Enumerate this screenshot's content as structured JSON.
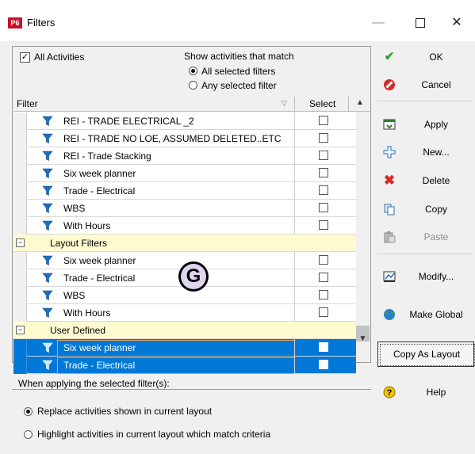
{
  "window": {
    "app_badge": "P6",
    "title": "Filters",
    "minimize": "—",
    "close": "✕"
  },
  "options": {
    "all_activities_label": "All Activities",
    "all_activities_checked": true,
    "show_match_label": "Show activities that match",
    "match_all_label": "All selected filters",
    "match_any_label": "Any selected filter",
    "selected_match": "all"
  },
  "grid": {
    "col_filter": "Filter",
    "col_select": "Select",
    "rows": [
      {
        "type": "item",
        "label": "REI - TRADE ELECTRICAL _2"
      },
      {
        "type": "item",
        "label": "REI - TRADE NO LOE, ASSUMED DELETED..ETC"
      },
      {
        "type": "item",
        "label": "REI - Trade Stacking"
      },
      {
        "type": "item",
        "label": "Six week planner"
      },
      {
        "type": "item",
        "label": "Trade - Electrical"
      },
      {
        "type": "item",
        "label": "WBS"
      },
      {
        "type": "item",
        "label": "With Hours"
      },
      {
        "type": "group",
        "label": "Layout Filters",
        "expander": "−"
      },
      {
        "type": "item",
        "label": "Six week planner"
      },
      {
        "type": "item",
        "label": "Trade - Electrical"
      },
      {
        "type": "item",
        "label": "WBS"
      },
      {
        "type": "item",
        "label": "With Hours"
      },
      {
        "type": "group",
        "label": "User Defined",
        "expander": "−"
      },
      {
        "type": "selected",
        "label": "Six week planner"
      },
      {
        "type": "selected",
        "label": "Trade - Electrical"
      }
    ]
  },
  "overlay_logo": "G",
  "apply_section": {
    "label": "When applying the selected filter(s):",
    "replace_label": "Replace activities shown in current layout",
    "highlight_label": "Highlight activities in current layout which match criteria",
    "selected": "replace"
  },
  "buttons": {
    "ok": "OK",
    "cancel": "Cancel",
    "apply": "Apply",
    "new": "New...",
    "delete": "Delete",
    "copy": "Copy",
    "paste": "Paste",
    "modify": "Modify...",
    "make_global": "Make Global",
    "copy_as_layout": "Copy As Layout",
    "help": "Help"
  },
  "icons": {
    "filter": "funnel-icon",
    "ok": "checkmark-icon",
    "cancel": "prohibited-icon",
    "apply": "apply-icon",
    "new": "new-icon",
    "delete": "x-icon",
    "copy": "copy-icon",
    "paste": "paste-icon",
    "modify": "modify-icon",
    "make_global": "globe-icon",
    "help": "help-icon"
  },
  "colors": {
    "selection": "#0078d7",
    "group_row": "#fffbd0",
    "filter_icon": "#1a6fc2"
  }
}
